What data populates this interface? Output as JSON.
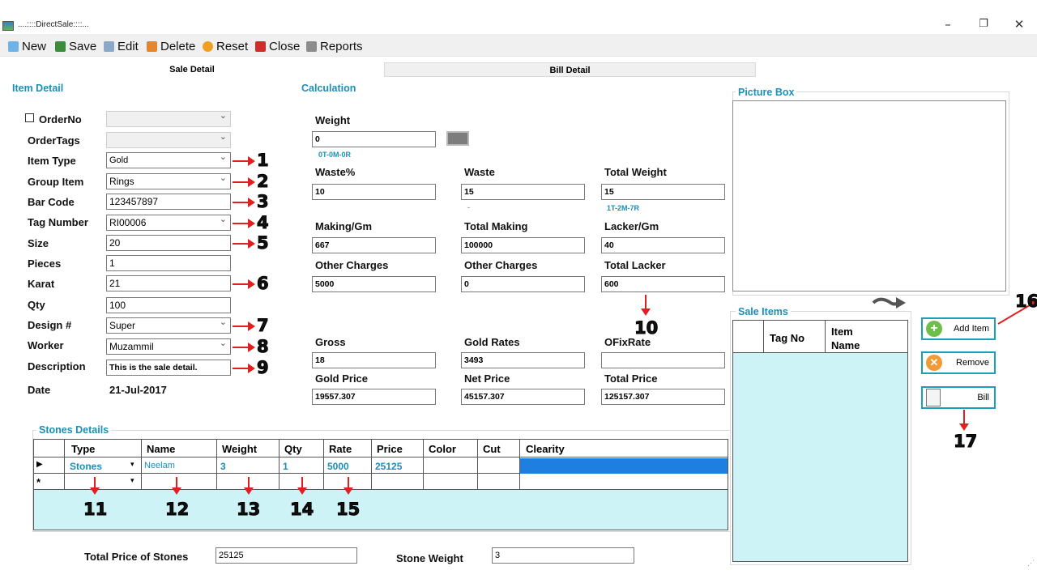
{
  "window": {
    "title": "....::::DirectSale::::..."
  },
  "toolbar": {
    "new": "New",
    "save": "Save",
    "edit": "Edit",
    "delete": "Delete",
    "reset": "Reset",
    "close": "Close",
    "reports": "Reports"
  },
  "tabs": {
    "sale_detail": "Sale Detail",
    "bill_detail": "Bill Detail"
  },
  "item_detail": {
    "title": "Item Detail",
    "order_no_label": "OrderNo",
    "order_tags_label": "OrderTags",
    "item_type_label": "Item Type",
    "item_type": "Gold",
    "group_item_label": "Group Item",
    "group_item": "Rings",
    "bar_code_label": "Bar Code",
    "bar_code": "123457897",
    "tag_number_label": "Tag Number",
    "tag_number": "RI00006",
    "size_label": "Size",
    "size": "20",
    "pieces_label": "Pieces",
    "pieces": "1",
    "karat_label": "Karat",
    "karat": "21",
    "qty_label": "Qty",
    "qty": "100",
    "design_label": "Design #",
    "design": "Super",
    "worker_label": "Worker",
    "worker": "Muzammil",
    "description_label": "Description",
    "description": "This is the sale detail.",
    "date_label": "Date",
    "date": "21-Jul-2017"
  },
  "calculation": {
    "title": "Calculation",
    "weight_label": "Weight",
    "weight": "0",
    "weight_hint": "0T-0M-0R",
    "waste_pct_label": "Waste%",
    "waste_pct": "10",
    "waste_label": "Waste",
    "waste": "15",
    "waste_hint": "-",
    "total_weight_label": "Total Weight",
    "total_weight": "15",
    "total_weight_hint": "1T-2M-7R",
    "making_gm_label": "Making/Gm",
    "making_gm": "667",
    "total_making_label": "Total Making",
    "total_making": "100000",
    "lacker_gm_label": "Lacker/Gm",
    "lacker_gm": "40",
    "other_charges_label": "Other Charges",
    "other_charges": "5000",
    "other_charges2_label": "Other Charges",
    "other_charges2": "0",
    "total_lacker_label": "Total Lacker",
    "total_lacker": "600",
    "gross_label": "Gross",
    "gross": "18",
    "gold_rates_label": "Gold Rates",
    "gold_rates": "3493",
    "ofix_rate_label": "OFixRate",
    "ofix_rate": "",
    "gold_price_label": "Gold Price",
    "gold_price": "19557.307",
    "net_price_label": "Net Price",
    "net_price": "45157.307",
    "total_price_label": "Total Price",
    "total_price": "125157.307"
  },
  "picture_box": {
    "title": "Picture Box"
  },
  "sale_items": {
    "title": "Sale Items",
    "col_tag_no": "Tag No",
    "col_item_name": "Item Name"
  },
  "buttons": {
    "add_item": "Add Item",
    "remove": "Remove",
    "bill": "Bill"
  },
  "stones": {
    "title": "Stones Details",
    "columns": [
      "Type",
      "Name",
      "Weight",
      "Qty",
      "Rate",
      "Price",
      "Color",
      "Cut",
      "Clearity"
    ],
    "row": {
      "type": "Stones",
      "name": "Neelam",
      "weight": "3",
      "qty": "1",
      "rate": "5000",
      "price": "25125"
    },
    "new_row_marker": "*"
  },
  "totals": {
    "total_price_stones_label": "Total Price of Stones",
    "total_price_stones": "25125",
    "stone_weight_label": "Stone Weight",
    "stone_weight": "3"
  },
  "annotations": [
    "1",
    "2",
    "3",
    "4",
    "5",
    "6",
    "7",
    "8",
    "9",
    "10",
    "11",
    "12",
    "13",
    "14",
    "15",
    "16",
    "17"
  ],
  "colors": {
    "accent": "#1a8fb8",
    "arrow": "#e02020",
    "grid_bg": "#cdf3f7",
    "selected": "#1e7fe0"
  }
}
